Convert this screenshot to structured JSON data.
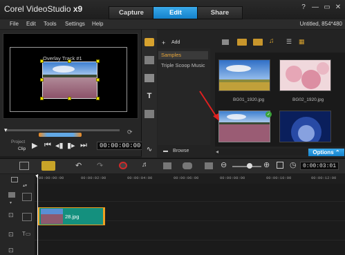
{
  "app": {
    "title_prefix": "Corel VideoStudio",
    "title_version": "x9",
    "doc_title": "Untitled, 854*480"
  },
  "tabs": [
    {
      "label": "Capture",
      "active": false
    },
    {
      "label": "Edit",
      "active": true
    },
    {
      "label": "Share",
      "active": false
    }
  ],
  "window_buttons": {
    "help": "?",
    "minimize": "—",
    "maximize": "▭",
    "close": "✕"
  },
  "menu": [
    "File",
    "Edit",
    "Tools",
    "Settings",
    "Help"
  ],
  "preview": {
    "overlay_label": "Overlay Track #1",
    "project_label": "Project",
    "clip_label": "Clip",
    "timecode": "00:00:00:00"
  },
  "library": {
    "add_label": "Add",
    "categories": [
      "Samples",
      "Triple Scoop Music"
    ],
    "browse_label": "Browse",
    "options_label": "Options",
    "thumbnails": [
      {
        "label": "BG01_1920.jpg",
        "kind": "field-sky"
      },
      {
        "label": "BG02_1920.jpg",
        "kind": "pink-flowers"
      },
      {
        "label": "",
        "kind": "flower-field",
        "checked": true
      },
      {
        "label": "",
        "kind": "blue-night"
      }
    ]
  },
  "timeline": {
    "timecode": "0:00:03:01",
    "ruler": [
      "00:00:00:00",
      "00:00:02:00",
      "00:00:04:00",
      "00:00:06:00",
      "00:00:08:00",
      "00:00:10:00",
      "00:00:12:00"
    ],
    "clip_name": "28.jpg"
  },
  "colors": {
    "accent": "#1e93dc",
    "clip": "#14907e",
    "clip_border": "#f0a020",
    "handle": "#f0e500"
  }
}
